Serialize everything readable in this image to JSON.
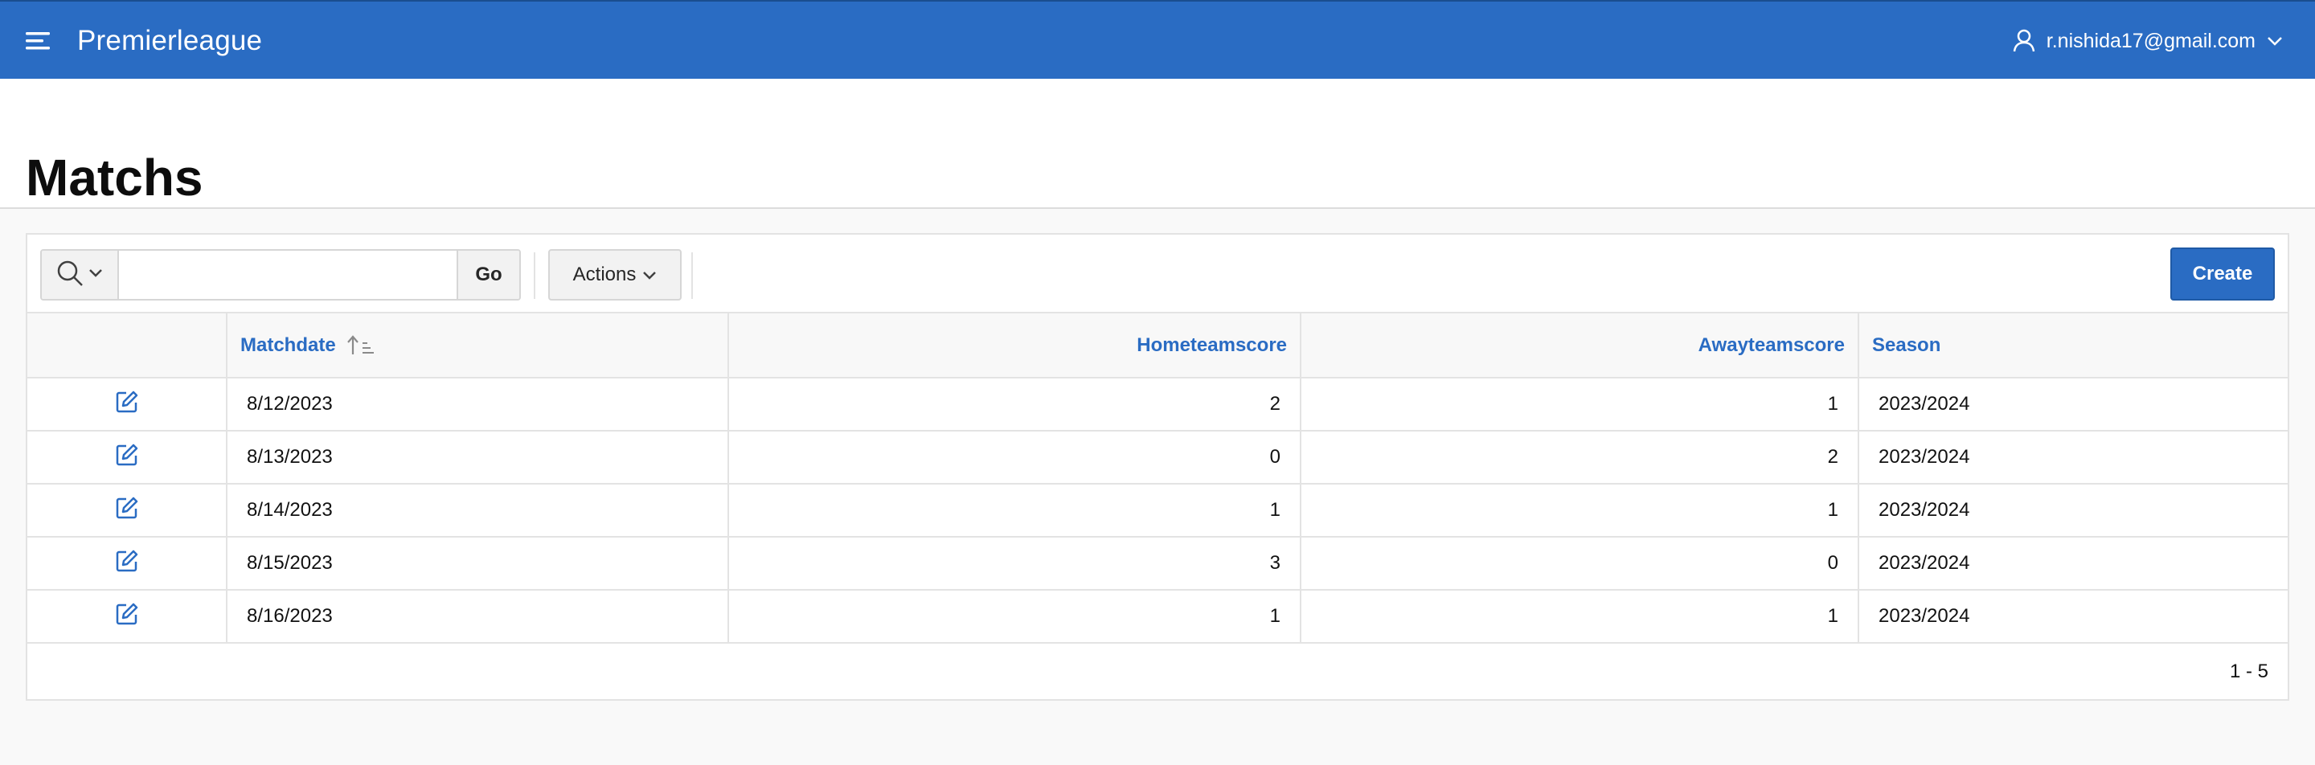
{
  "header": {
    "app_title": "Premierleague",
    "user_email": "r.nishida17@gmail.com",
    "brand_color": "#2a6cc3"
  },
  "page": {
    "title": "Matchs"
  },
  "toolbar": {
    "search_value": "",
    "go_label": "Go",
    "actions_label": "Actions",
    "create_label": "Create"
  },
  "table": {
    "columns": [
      {
        "label": "",
        "name": "edit"
      },
      {
        "label": "Matchdate",
        "name": "matchdate",
        "sorted": "ascending"
      },
      {
        "label": "Hometeamscore",
        "name": "hometeamscore"
      },
      {
        "label": "Awayteamscore",
        "name": "awayteamscore"
      },
      {
        "label": "Season",
        "name": "season"
      }
    ],
    "rows": [
      {
        "matchdate": "8/12/2023",
        "hometeamscore": "2",
        "awayteamscore": "1",
        "season": "2023/2024"
      },
      {
        "matchdate": "8/13/2023",
        "hometeamscore": "0",
        "awayteamscore": "2",
        "season": "2023/2024"
      },
      {
        "matchdate": "8/14/2023",
        "hometeamscore": "1",
        "awayteamscore": "1",
        "season": "2023/2024"
      },
      {
        "matchdate": "8/15/2023",
        "hometeamscore": "3",
        "awayteamscore": "0",
        "season": "2023/2024"
      },
      {
        "matchdate": "8/16/2023",
        "hometeamscore": "1",
        "awayteamscore": "1",
        "season": "2023/2024"
      }
    ]
  },
  "pagination": {
    "range": "1 - 5"
  }
}
